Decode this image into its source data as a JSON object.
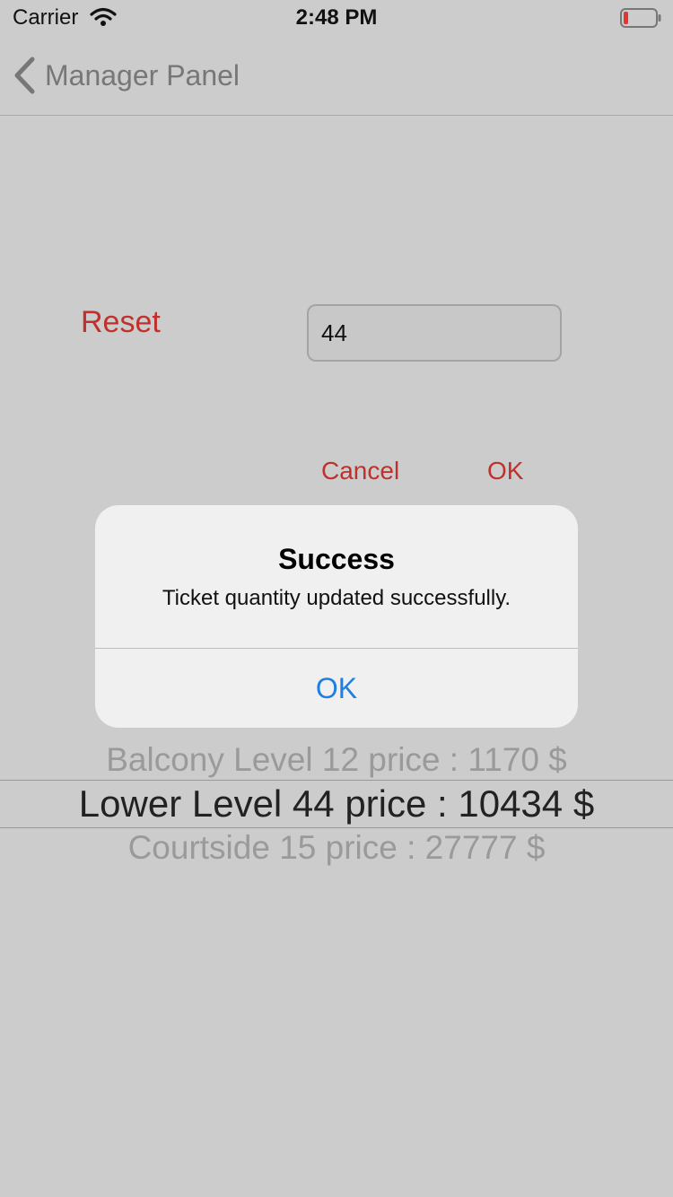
{
  "status_bar": {
    "carrier": "Carrier",
    "time": "2:48 PM",
    "wifi_icon": "wifi-icon",
    "battery_icon": "battery-low-icon",
    "battery_color": "#e5342c"
  },
  "nav": {
    "back_icon": "chevron-left-icon",
    "back_label": "Manager Panel"
  },
  "form": {
    "reset_label": "Reset",
    "quantity_value": "44",
    "cancel_label": "Cancel",
    "ok_label": "OK"
  },
  "picker": {
    "rows": [
      "Balcony Level 12 price : 1170 $",
      "Lower Level 44 price : 10434 $",
      "Courtside 15 price : 27777 $"
    ],
    "selected_index": 1
  },
  "alert": {
    "title": "Success",
    "message": "Ticket quantity updated successfully.",
    "ok_label": "OK"
  },
  "colors": {
    "accent_red": "#c0302c",
    "alert_button_blue": "#1f7fe0",
    "background": "#cccccc"
  }
}
